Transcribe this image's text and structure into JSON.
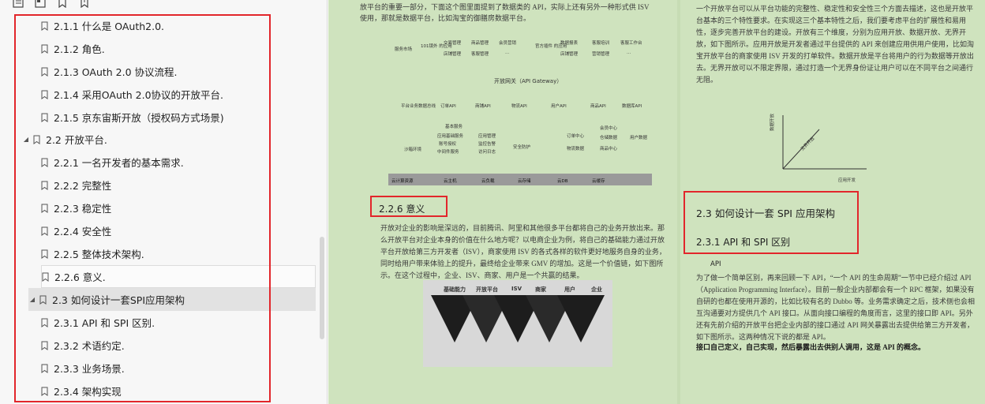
{
  "toolbar": {
    "icons": [
      "toc-icon",
      "outline-icon",
      "bookmark-icon",
      "bookmark-add-icon"
    ]
  },
  "toc": {
    "items": [
      {
        "label": "2.1.1 什么是 OAuth2.0."
      },
      {
        "label": "2.1.2 角色."
      },
      {
        "label": "2.1.3 OAuth 2.0 协议流程."
      },
      {
        "label": "2.1.4 采用OAuth 2.0协议的开放平台."
      },
      {
        "label": "2.1.5 京东宙斯开放（授权码方式场景)"
      },
      {
        "label": "2.2 开放平台."
      },
      {
        "label": "2.2.1 一名开发者的基本需求."
      },
      {
        "label": "2.2.2 完整性"
      },
      {
        "label": "2.2.3 稳定性"
      },
      {
        "label": "2.2.4 安全性"
      },
      {
        "label": "2.2.5 整体技术架构."
      },
      {
        "label": "2.2.6 意义."
      },
      {
        "label": "2.3 如何设计一套SPI应用架构"
      },
      {
        "label": "2.3.1 API 和 SPI 区别."
      },
      {
        "label": "2.3.2 术语约定."
      },
      {
        "label": "2.3.3 业务场景."
      },
      {
        "label": "2.3.4 架构实现"
      }
    ]
  },
  "left_page": {
    "top_text_1": "放平台的重要一部分，下面这个图里面提到了数据类的 API，实际上还有另外一种形式供 ISV",
    "top_text_2": "使用，那就是数据平台，比如淘宝的御膳房数据平台。",
    "arch": {
      "row1": [
        "服务市场",
        "101镜外\n的应用",
        "交易管理",
        "商品管理",
        "会员营销",
        "官方插件\n的应用",
        "数据报表",
        "客服培训",
        "客服工作台"
      ],
      "row1b": [
        "店铺管理",
        "客服管理",
        "...",
        "店铺管理",
        "营销管理",
        "..."
      ],
      "gateway": "开放网关（API Gateway）",
      "row2": [
        "平台业务数据总线",
        "订单API",
        "商铺API",
        "物流API",
        "用户API",
        "商品API",
        "数据库API"
      ],
      "row3": [
        "沙箱环境",
        "基本服务",
        "应用基础服务",
        "账号授权",
        "中间件服务",
        "应用管理",
        "监控告警",
        "访问日志",
        "安全防护",
        "订单中心",
        "物流数据",
        "会员中心",
        "仓储数据",
        "商品中心",
        "用户数据"
      ],
      "bottom": [
        "云计算资源",
        "云主机",
        "云负载",
        "云存储",
        "云DB",
        "云缓存"
      ]
    },
    "heading": "2.2.6   意义",
    "para": "开放对企业的影响是深远的，目前腾讯、阿里和其他很多平台都将自己的业务开放出来。那么开放平台对企业本身的价值在什么地方呢？以电商企业为例，将自己的基础能力通过开放平台开放给第三方开发者（ISV），商家使用 ISV 的各式各样的软件更好地服务自身的业务，同时给用户带来体验上的提升，最终给企业带来 GMV 的增加。这是一个价值链，如下图所示。在这个过程中，企业、ISV、商家、用户是一个共赢的结果。",
    "chain_labels": [
      "基础能力",
      "开放平台",
      "ISV",
      "商家",
      "用户",
      "企业"
    ]
  },
  "right_page": {
    "top_para": "一个开放平台可以从平台功能的完整性、稳定性和安全性三个方面去描述，这也是开放平台基本的三个特性要求。在实现这三个基本特性之后，我们要考虑平台的扩展性和易用性，逐步完善开放平台的建设。开放有三个维度，分别为应用开放、数据开放、无界开放，如下图所示。应用开放是开发者通过平台提供的 API 来创建应用供用户使用，比如淘宝开放平台的商家使用 ISV 开发的打单软件。数据开放是平台将用户的行为数据等开放出去。无界开放可以不限定界限，通过打造一个无界身份证让用户可以在不同平台之间通行无阻。",
    "chart": {
      "y_label": "数据开放",
      "x_label": "应用开发",
      "diag_label": "无界开放"
    },
    "h23": "2.3   如何设计一套 SPI 应用架构",
    "h231": "2.3.1   API 和 SPI 区别",
    "api": "API",
    "para2": "为了做一个简单区别，再来回顾一下 API，“一个 API 的生命周期”一节中已经介绍过 API（Application Programming Interface）。目前一般企业内部都会有一个 RPC 框架，如果没有自研的也都在使用开源的，比如比较有名的 Dubbo 等。业务需求确定之后，技术侧也会相互沟通要对方提供几个 API 接口。从面向接口编程的角度而言，这里的接口即 API。另外还有先前介绍的开放平台把企业内部的接口通过 API 网关暴露出去提供给第三方开发者，如下图所示。这两种情况下说的都是 API。",
    "bold_tail": "接口自己定义，自己实现，然后暴露出去供别人调用，这是 API 的概念。"
  }
}
